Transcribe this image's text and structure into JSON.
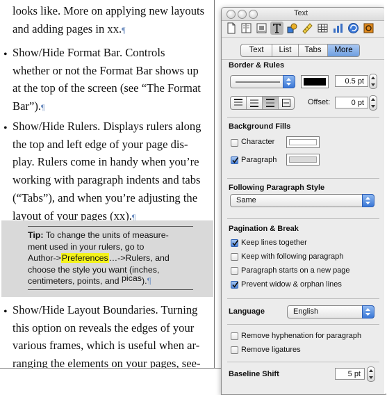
{
  "document": {
    "paragraph_top": {
      "lines": [
        "looks like. More on applying new layouts",
        "and adding pages in xx."
      ]
    },
    "bullets": [
      {
        "lines": [
          "Show/Hide Format Bar. Controls",
          "whether or not the Format Bar shows up",
          "at the top of the screen (see “The Format",
          "Bar”)."
        ]
      },
      {
        "lines": [
          "Show/Hide Rulers. Displays rulers along",
          "the top and left edge of your page dis-",
          "play. Rulers come in handy when you’re",
          "working with paragraph indents and tabs",
          "(“Tabs”), and when you’re adjusting the",
          "layout of your pages (xx)."
        ]
      },
      {
        "lines": [
          "Show/Hide Layout Boundaries. Turning",
          "this option on reveals the edges of your",
          "various frames, which is useful when ar-",
          "ranging the elements on your pages, see-"
        ]
      }
    ],
    "tip": {
      "label": "Tip:",
      "line1": "To change the units of measure-",
      "line2": "ment used in your rulers, go to",
      "line3_before": "Author->",
      "line3_highlight": "Preferences",
      "line3_after": "…->Rulers, and",
      "line4": "choose the style you want (inches,",
      "line5": "centimeters, points, and",
      "line5_end": "picas",
      "line5_tail": ")."
    },
    "pilcrow": "¶"
  },
  "inspector": {
    "title": "Text",
    "toolbar_icons": [
      "document-icon",
      "layout-icon",
      "wrap-icon",
      "text-icon",
      "graphic-icon",
      "metrics-icon",
      "table-icon",
      "chart-icon",
      "link-icon",
      "quicktime-icon"
    ],
    "selected_tool": "text-icon",
    "tabs": [
      "Text",
      "List",
      "Tabs",
      "More"
    ],
    "active_tab": "More",
    "border_rules": {
      "heading": "Border & Rules",
      "line_width": "0.5 pt",
      "offset_label": "Offset:",
      "offset_value": "0 pt",
      "line_color": "#000000"
    },
    "background_fills": {
      "heading": "Background Fills",
      "character_label": "Character",
      "character_checked": false,
      "paragraph_label": "Paragraph",
      "paragraph_checked": true
    },
    "following_style": {
      "heading": "Following Paragraph Style",
      "value": "Same"
    },
    "pagination": {
      "heading": "Pagination & Break",
      "options": [
        {
          "label": "Keep lines together",
          "checked": true
        },
        {
          "label": "Keep with following paragraph",
          "checked": false
        },
        {
          "label": "Paragraph starts on a new page",
          "checked": false
        },
        {
          "label": "Prevent widow & orphan lines",
          "checked": true
        }
      ]
    },
    "language": {
      "label": "Language",
      "value": "English"
    },
    "hyphenation": {
      "remove_hyphenation": "Remove hyphenation for paragraph",
      "remove_hyphenation_checked": false,
      "remove_ligatures": "Remove ligatures",
      "remove_ligatures_checked": false
    },
    "baseline_shift": {
      "label": "Baseline Shift",
      "value": "5 pt"
    }
  }
}
